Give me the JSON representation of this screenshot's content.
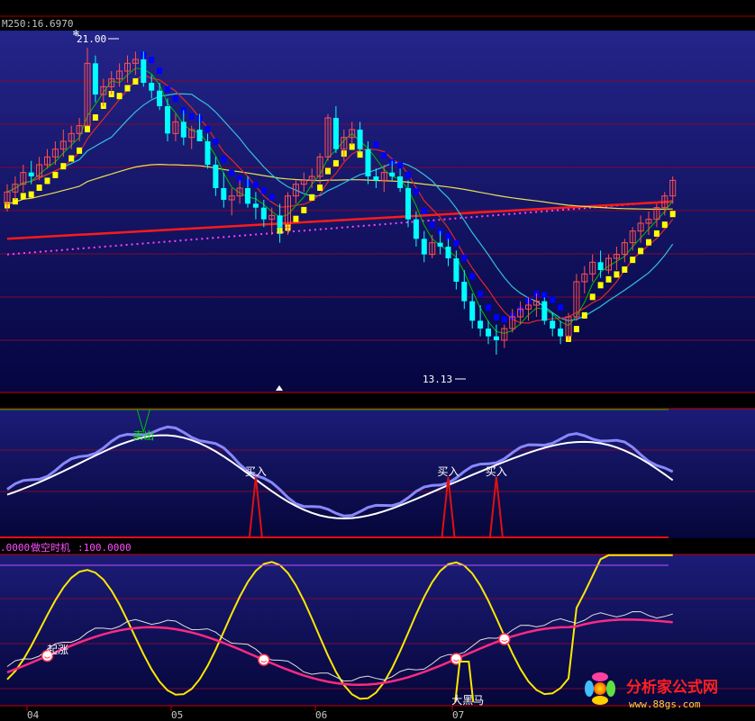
{
  "header": {
    "label": "M250:16.6970"
  },
  "nav": {
    "left_label": "⇦",
    "right_label": "⇨"
  },
  "chart_data": [
    {
      "type": "candlestick",
      "annotations": {
        "high_label": "21.00",
        "low_label": "13.13"
      },
      "ylim": [
        12.3,
        21.3
      ],
      "grid": true,
      "colors": {
        "up": "#ff5050",
        "down": "#00ffff",
        "ma_fast": "#00c000",
        "ma_mid": "#e02828",
        "ma_slow": "#30c0e0",
        "ma_long": "#e8e050",
        "ma_250": "#ff1a1a",
        "dotted": "#ff40ff",
        "stair_up": "#ffff00",
        "stair_down": "#0000ff"
      },
      "candles": [
        [
          17.0,
          17.5,
          16.8,
          17.3
        ],
        [
          17.3,
          17.7,
          17.1,
          17.5
        ],
        [
          17.5,
          18.0,
          17.3,
          17.8
        ],
        [
          17.8,
          18.1,
          17.5,
          17.7
        ],
        [
          17.7,
          18.2,
          17.6,
          18.0
        ],
        [
          18.0,
          18.4,
          17.9,
          18.2
        ],
        [
          18.2,
          18.6,
          18.0,
          18.4
        ],
        [
          18.4,
          18.9,
          18.2,
          18.6
        ],
        [
          18.6,
          19.0,
          18.4,
          18.8
        ],
        [
          18.8,
          19.2,
          18.6,
          19.0
        ],
        [
          19.0,
          21.0,
          19.0,
          20.6
        ],
        [
          20.6,
          20.8,
          19.6,
          19.8
        ],
        [
          19.8,
          20.2,
          19.5,
          20.0
        ],
        [
          20.0,
          20.4,
          19.8,
          20.2
        ],
        [
          20.2,
          20.6,
          20.0,
          20.4
        ],
        [
          20.4,
          20.8,
          20.1,
          20.6
        ],
        [
          20.6,
          20.9,
          20.3,
          20.7
        ],
        [
          20.7,
          20.9,
          20.0,
          20.1
        ],
        [
          20.1,
          20.3,
          19.7,
          19.9
        ],
        [
          19.9,
          20.1,
          19.4,
          19.5
        ],
        [
          19.5,
          19.7,
          18.6,
          18.8
        ],
        [
          18.8,
          19.3,
          18.6,
          19.1
        ],
        [
          19.1,
          19.4,
          18.5,
          18.7
        ],
        [
          18.7,
          19.0,
          18.4,
          18.9
        ],
        [
          18.9,
          19.3,
          18.6,
          18.6
        ],
        [
          18.6,
          18.8,
          17.9,
          18.0
        ],
        [
          18.0,
          18.2,
          17.2,
          17.4
        ],
        [
          17.4,
          17.8,
          16.9,
          17.1
        ],
        [
          17.1,
          17.4,
          16.7,
          17.2
        ],
        [
          17.2,
          17.6,
          17.0,
          17.4
        ],
        [
          17.4,
          17.7,
          16.9,
          17.0
        ],
        [
          17.0,
          17.3,
          16.6,
          16.9
        ],
        [
          16.9,
          17.1,
          16.4,
          16.6
        ],
        [
          16.6,
          16.9,
          16.2,
          16.7
        ],
        [
          16.7,
          17.0,
          16.0,
          16.4
        ],
        [
          16.4,
          17.3,
          16.2,
          17.2
        ],
        [
          17.2,
          17.6,
          17.0,
          17.5
        ],
        [
          17.5,
          17.8,
          17.3,
          17.6
        ],
        [
          17.6,
          17.9,
          17.4,
          17.7
        ],
        [
          17.7,
          18.3,
          17.5,
          18.2
        ],
        [
          18.2,
          19.3,
          18.1,
          19.2
        ],
        [
          19.2,
          19.5,
          18.3,
          18.4
        ],
        [
          18.4,
          18.9,
          18.1,
          18.7
        ],
        [
          18.7,
          19.1,
          18.5,
          18.9
        ],
        [
          18.9,
          19.1,
          18.3,
          18.4
        ],
        [
          18.4,
          18.6,
          17.5,
          17.7
        ],
        [
          17.7,
          17.9,
          17.4,
          17.6
        ],
        [
          17.6,
          18.0,
          17.3,
          17.8
        ],
        [
          17.8,
          18.1,
          17.6,
          17.7
        ],
        [
          17.7,
          17.9,
          17.3,
          17.4
        ],
        [
          17.4,
          17.6,
          16.4,
          16.6
        ],
        [
          16.6,
          16.8,
          15.9,
          16.1
        ],
        [
          16.1,
          16.3,
          15.5,
          15.7
        ],
        [
          15.7,
          16.2,
          15.6,
          16.0
        ],
        [
          16.0,
          16.3,
          15.7,
          15.9
        ],
        [
          15.9,
          16.1,
          15.4,
          15.6
        ],
        [
          15.6,
          15.8,
          14.8,
          15.0
        ],
        [
          15.0,
          15.3,
          14.3,
          14.5
        ],
        [
          14.5,
          14.7,
          13.8,
          14.0
        ],
        [
          14.0,
          14.4,
          13.6,
          13.8
        ],
        [
          13.8,
          14.0,
          13.4,
          13.6
        ],
        [
          13.6,
          13.9,
          13.13,
          13.5
        ],
        [
          13.5,
          13.9,
          13.3,
          13.8
        ],
        [
          13.8,
          14.3,
          13.7,
          14.1
        ],
        [
          14.1,
          14.5,
          13.9,
          14.3
        ],
        [
          14.3,
          14.6,
          14.0,
          14.4
        ],
        [
          14.4,
          14.7,
          14.1,
          14.5
        ],
        [
          14.5,
          14.6,
          13.9,
          14.0
        ],
        [
          14.0,
          14.2,
          13.6,
          13.8
        ],
        [
          13.8,
          14.0,
          13.4,
          13.6
        ],
        [
          13.6,
          14.2,
          13.5,
          14.1
        ],
        [
          14.1,
          15.2,
          14.0,
          15.0
        ],
        [
          15.0,
          15.4,
          14.7,
          15.2
        ],
        [
          15.2,
          15.7,
          15.0,
          15.5
        ],
        [
          15.5,
          15.8,
          15.1,
          15.3
        ],
        [
          15.3,
          15.7,
          15.2,
          15.6
        ],
        [
          15.6,
          15.9,
          15.3,
          15.7
        ],
        [
          15.7,
          16.1,
          15.5,
          16.0
        ],
        [
          16.0,
          16.4,
          15.8,
          16.3
        ],
        [
          16.3,
          16.7,
          16.0,
          16.5
        ],
        [
          16.5,
          16.8,
          16.2,
          16.6
        ],
        [
          16.6,
          17.0,
          16.4,
          16.9
        ],
        [
          16.9,
          17.3,
          16.7,
          17.2
        ],
        [
          17.2,
          17.7,
          17.0,
          17.6
        ]
      ]
    },
    {
      "type": "line",
      "series_colors": [
        "#ffffff",
        "#8888ff",
        "#e01010"
      ],
      "buy_label": "买入",
      "sell_label": "卖出",
      "buy_at": [
        31,
        55,
        61
      ],
      "sell_at": [
        17
      ]
    },
    {
      "type": "line",
      "legend": {
        "value_prefix": ".0000",
        "name": "做空时机",
        "name_value": ":100.0000"
      },
      "series_colors": [
        "#ffe800",
        "#e0e0e0",
        "#ff2a80"
      ],
      "smileys_at": [
        5,
        32,
        56,
        62
      ],
      "labels": {
        "rise": "起涨",
        "big_black": "大黑马"
      }
    }
  ],
  "x_axis": {
    "ticks": [
      "04",
      "05",
      "06",
      "07"
    ]
  },
  "watermark": {
    "text": "分析家公式网",
    "url": "www.88gs.com"
  }
}
